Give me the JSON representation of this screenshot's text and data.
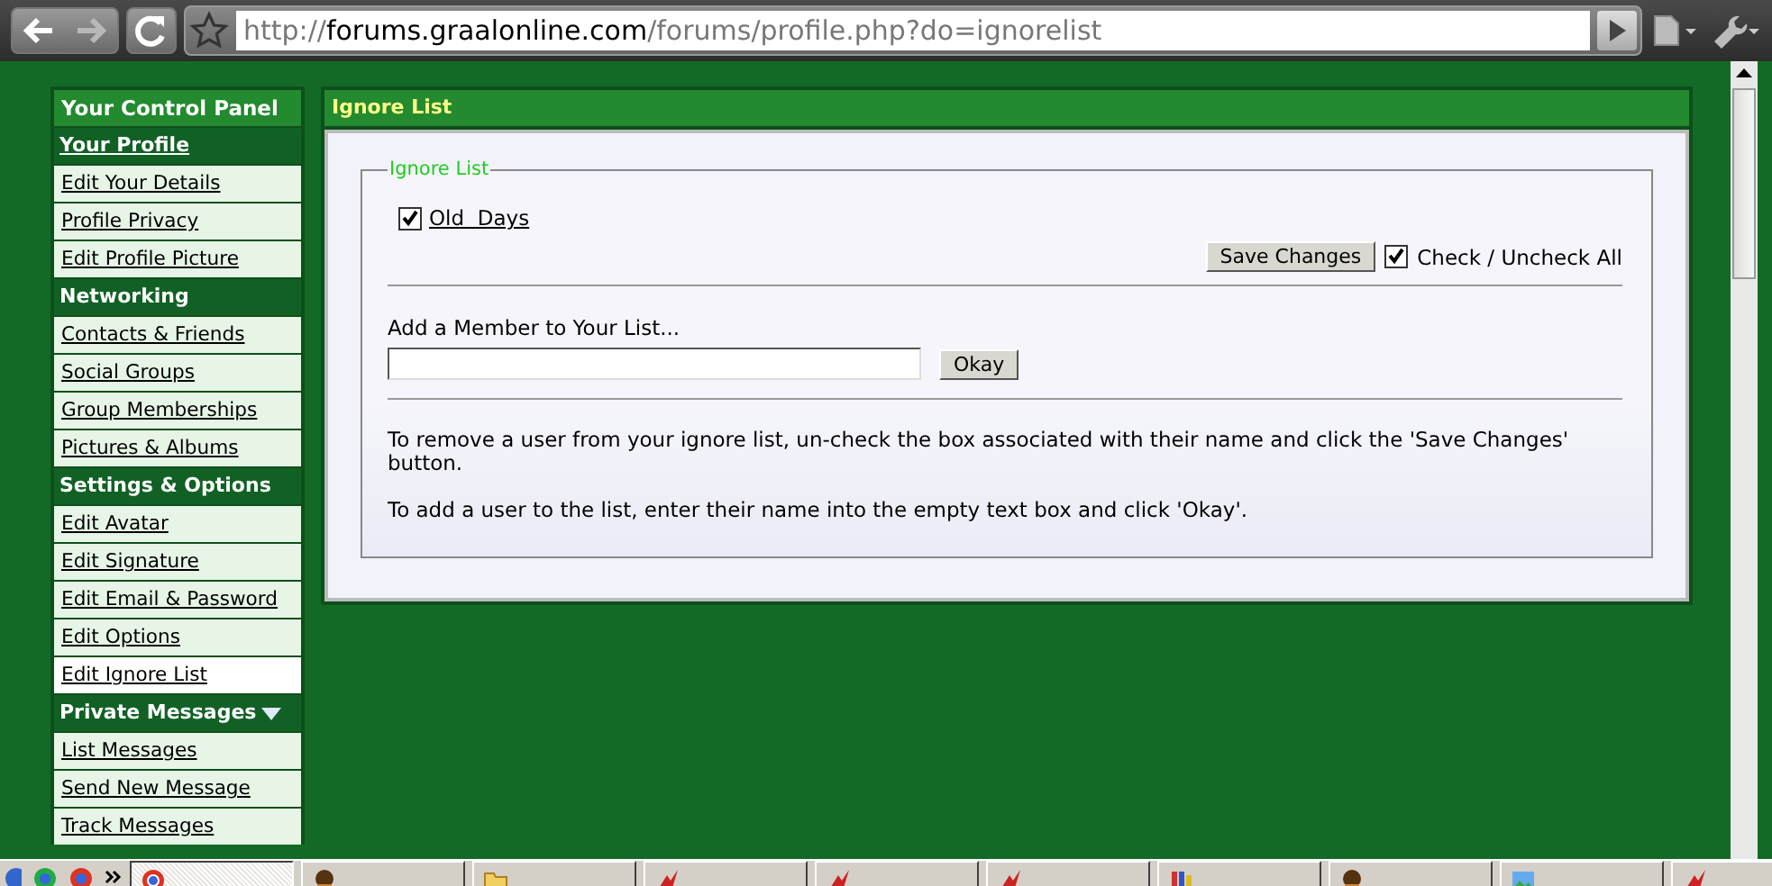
{
  "browser": {
    "url": "http://forums.graalonline.com/forums/profile.php?do=ignorelist"
  },
  "sidebar": {
    "title": "Your Control Panel",
    "sections": [
      {
        "heading": "Your Profile",
        "kind": "link",
        "items": [
          {
            "label": "Edit Your Details",
            "selected": false
          },
          {
            "label": "Profile Privacy",
            "selected": false
          },
          {
            "label": "Edit Profile Picture",
            "selected": false
          }
        ]
      },
      {
        "heading": "Networking",
        "kind": "plain",
        "items": [
          {
            "label": "Contacts & Friends",
            "selected": false
          },
          {
            "label": "Social Groups",
            "selected": false
          },
          {
            "label": "Group Memberships",
            "selected": false
          },
          {
            "label": "Pictures & Albums",
            "selected": false
          }
        ]
      },
      {
        "heading": "Settings & Options",
        "kind": "plain",
        "items": [
          {
            "label": "Edit Avatar",
            "selected": false
          },
          {
            "label": "Edit Signature",
            "selected": false
          },
          {
            "label": "Edit Email & Password",
            "selected": false
          },
          {
            "label": "Edit Options",
            "selected": false
          },
          {
            "label": "Edit Ignore List",
            "selected": true
          }
        ]
      },
      {
        "heading": "Private Messages",
        "kind": "menu",
        "items": [
          {
            "label": "List Messages",
            "selected": false
          },
          {
            "label": "Send New Message",
            "selected": false
          },
          {
            "label": "Track Messages",
            "selected": false
          }
        ]
      }
    ]
  },
  "panel": {
    "title": "Ignore List",
    "legend": "Ignore List",
    "entries": [
      {
        "name": "Old  Days",
        "checked": true
      }
    ],
    "save_button": "Save Changes",
    "check_all": {
      "label": "Check / Uncheck All",
      "checked": true
    },
    "add_label": "Add a Member to Your List...",
    "okay_button": "Okay",
    "help": [
      "To remove a user from your ignore list, un-check the box associated with their name and click the 'Save Changes' button.",
      "To add a user to the list, enter their name into the empty text box and click 'Okay'."
    ]
  },
  "taskbar": {
    "items": [
      {
        "kind": "browser",
        "selected": true
      },
      {
        "kind": "person",
        "selected": false
      },
      {
        "kind": "folder",
        "selected": false
      },
      {
        "kind": "flash",
        "selected": false
      },
      {
        "kind": "flash",
        "selected": false
      },
      {
        "kind": "flash",
        "selected": false
      },
      {
        "kind": "paint",
        "selected": false
      },
      {
        "kind": "person",
        "selected": false
      },
      {
        "kind": "landscape",
        "selected": false
      },
      {
        "kind": "flash",
        "selected": false
      }
    ]
  }
}
